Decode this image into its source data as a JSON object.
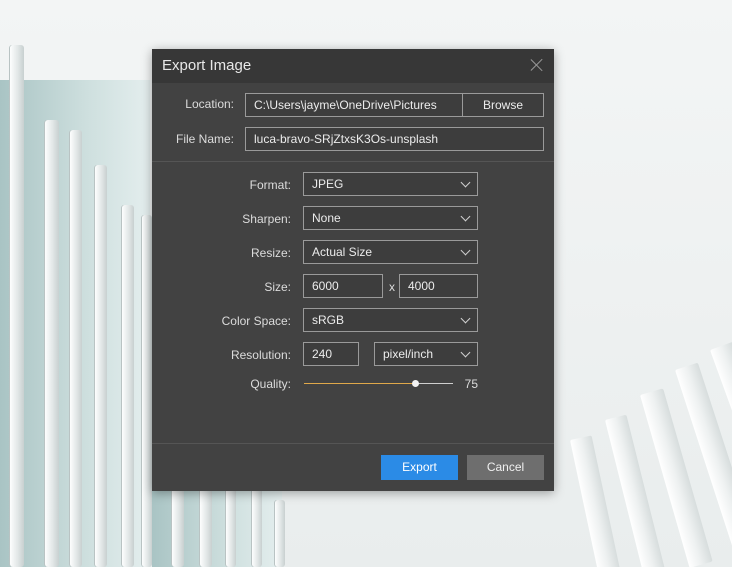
{
  "dialog": {
    "title": "Export Image",
    "location": {
      "label": "Location:",
      "value": "C:\\Users\\jayme\\OneDrive\\Pictures",
      "browse_label": "Browse"
    },
    "file_name": {
      "label": "File Name:",
      "value": "luca-bravo-SRjZtxsK3Os-unsplash"
    },
    "format": {
      "label": "Format:",
      "value": "JPEG"
    },
    "sharpen": {
      "label": "Sharpen:",
      "value": "None"
    },
    "resize": {
      "label": "Resize:",
      "value": "Actual Size"
    },
    "size": {
      "label": "Size:",
      "width": "6000",
      "separator": "x",
      "height": "4000"
    },
    "color_space": {
      "label": "Color Space:",
      "value": "sRGB"
    },
    "resolution": {
      "label": "Resolution:",
      "value": "240",
      "unit": "pixel/inch"
    },
    "quality": {
      "label": "Quality:",
      "value": "75",
      "level_fraction": 0.75
    },
    "export_label": "Export",
    "cancel_label": "Cancel"
  },
  "colors": {
    "accent": "#2b8be6",
    "dialog_bg": "#424242",
    "titlebar_bg": "#373737",
    "cancel_bg": "#6e6e6e",
    "slider_fill": "#e0a84a"
  },
  "icons": {
    "close": "close-icon",
    "dropdown": "chevron-down-icon"
  }
}
